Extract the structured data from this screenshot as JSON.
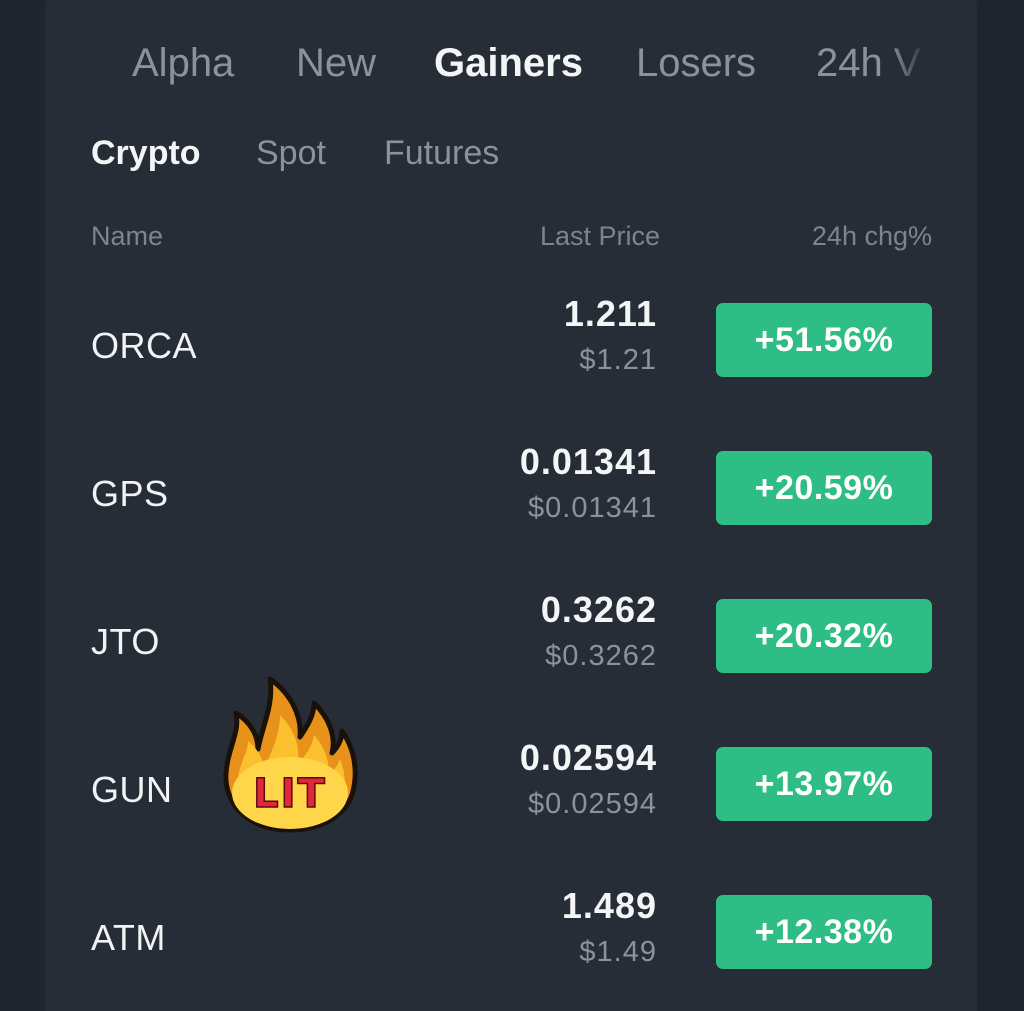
{
  "tabs": [
    {
      "label": "Alpha",
      "active": false
    },
    {
      "label": "New",
      "active": false
    },
    {
      "label": "Gainers",
      "active": true
    },
    {
      "label": "Losers",
      "active": false
    },
    {
      "label": "24h V",
      "active": false
    }
  ],
  "subtabs": [
    {
      "label": "Crypto",
      "active": true
    },
    {
      "label": "Spot",
      "active": false
    },
    {
      "label": "Futures",
      "active": false
    }
  ],
  "columns": {
    "name": "Name",
    "last_price": "Last Price",
    "change": "24h chg%"
  },
  "rows": [
    {
      "name": "ORCA",
      "price": "1.211",
      "usd": "$1.21",
      "change": "+51.56%"
    },
    {
      "name": "GPS",
      "price": "0.01341",
      "usd": "$0.01341",
      "change": "+20.59%"
    },
    {
      "name": "JTO",
      "price": "0.3262",
      "usd": "$0.3262",
      "change": "+20.32%"
    },
    {
      "name": "GUN",
      "price": "0.02594",
      "usd": "$0.02594",
      "change": "+13.97%"
    },
    {
      "name": "ATM",
      "price": "1.489",
      "usd": "$1.49",
      "change": "+12.38%"
    }
  ],
  "sticker": {
    "text": "LIT",
    "icon": "fire-icon"
  },
  "colors": {
    "background": "#1f252d",
    "panel": "#262d37",
    "gain": "#2ebd85",
    "sticker_text": "#e0283a"
  }
}
